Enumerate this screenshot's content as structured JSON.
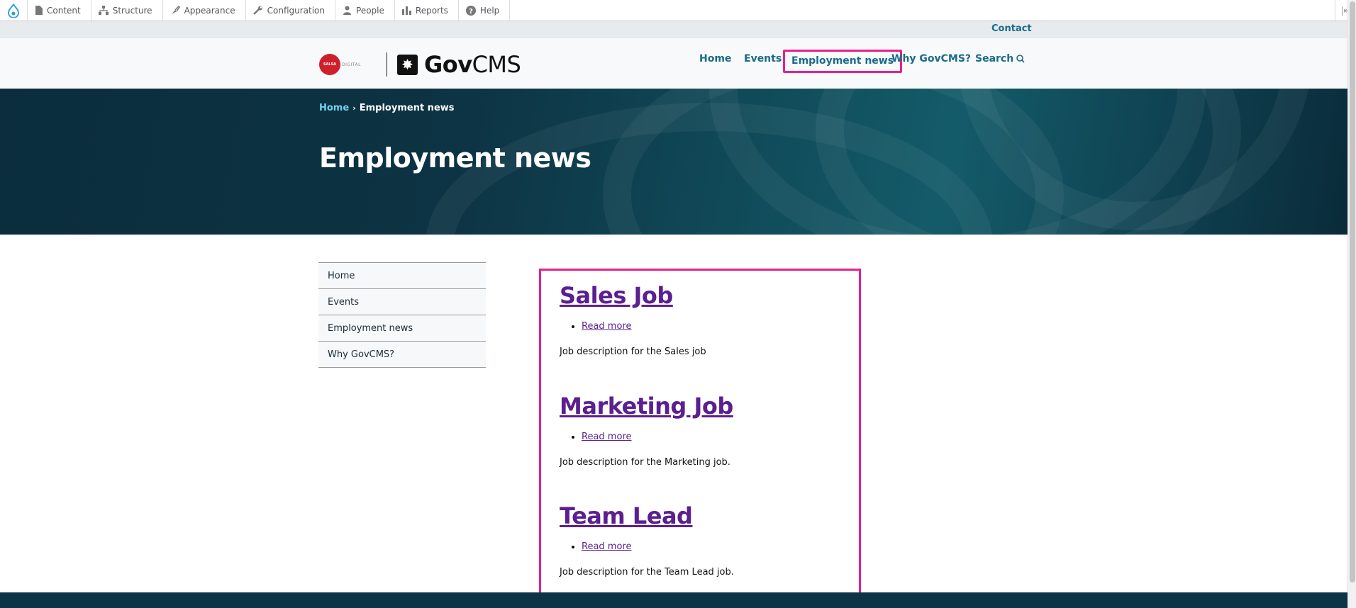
{
  "admin_toolbar": {
    "logo_icon": "drupal-drop-icon",
    "items": [
      {
        "label": "Content",
        "icon": "file-icon"
      },
      {
        "label": "Structure",
        "icon": "sitemap-icon"
      },
      {
        "label": "Appearance",
        "icon": "paintbrush-icon"
      },
      {
        "label": "Configuration",
        "icon": "wrench-icon"
      },
      {
        "label": "People",
        "icon": "person-icon"
      },
      {
        "label": "Reports",
        "icon": "bar-chart-icon"
      },
      {
        "label": "Help",
        "icon": "help-icon"
      }
    ],
    "collapse_icon": "toolbar-collapse-icon"
  },
  "utility": {
    "contact_label": "Contact"
  },
  "header": {
    "salsa_logo_text": "SALSA",
    "salsa_logo_suffix": "DIGITAL",
    "govcms_logo_bold": "Gov",
    "govcms_logo_regular": "CMS",
    "nav": [
      {
        "label": "Home"
      },
      {
        "label": "Events"
      },
      {
        "label": "Employment news"
      },
      {
        "label": "Why GovCMS?"
      },
      {
        "label": "Search"
      }
    ]
  },
  "banner": {
    "breadcrumb_home": "Home",
    "breadcrumb_separator": "›",
    "breadcrumb_current": "Employment news",
    "title": "Employment news"
  },
  "sidebar": {
    "items": [
      {
        "label": "Home"
      },
      {
        "label": "Events"
      },
      {
        "label": "Employment news"
      },
      {
        "label": "Why GovCMS?"
      }
    ]
  },
  "jobs": [
    {
      "title": "Sales Job",
      "link_label": "Read more",
      "description": "Job description for the Sales job"
    },
    {
      "title": "Marketing Job",
      "link_label": "Read more",
      "description": "Job description for the Marketing job."
    },
    {
      "title": "Team Lead",
      "link_label": "Read more",
      "description": "Job description for the Team Lead job."
    }
  ],
  "colors": {
    "accent_link": "#1a6b8a",
    "highlight_border": "#e4218f",
    "visited_link": "#5b1f8f",
    "banner_dark": "#0b2d3d",
    "breadcrumb_link": "#6fd3f2"
  }
}
